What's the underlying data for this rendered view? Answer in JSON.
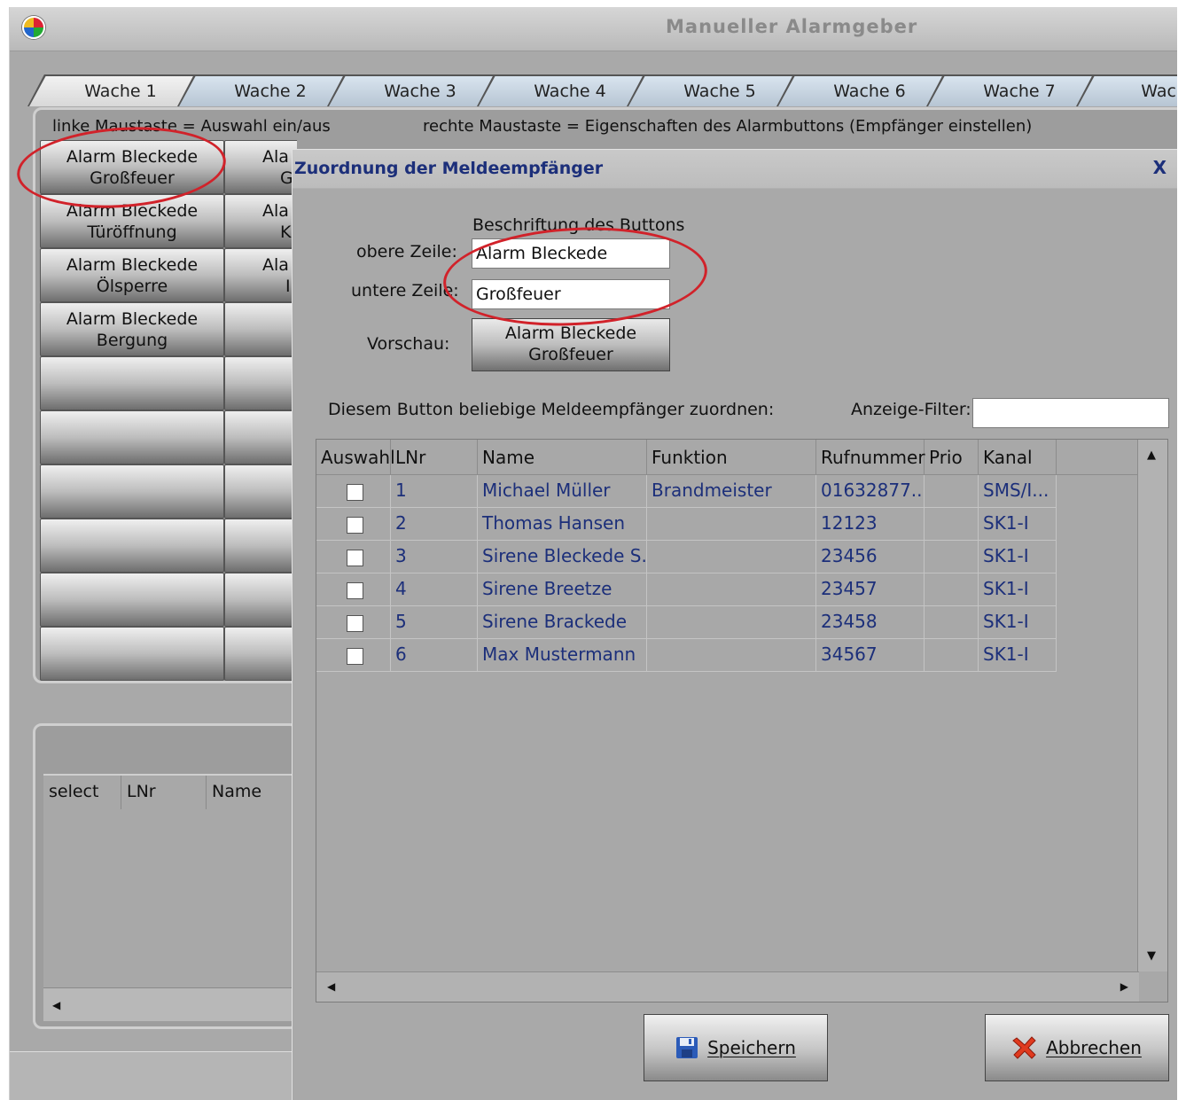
{
  "window": {
    "title": "Manueller Alarmgeber",
    "icon": "app-globe-icon"
  },
  "tabs": [
    "Wache 1",
    "Wache 2",
    "Wache 3",
    "Wache 4",
    "Wache 5",
    "Wache 6",
    "Wache 7",
    "Wache"
  ],
  "hints": {
    "left": "linke Maustaste = Auswahl ein/aus",
    "right": "rechte Maustaste = Eigenschaften des Alarmbuttons (Empfänger einstellen)"
  },
  "alarm_buttons": [
    {
      "line1": "Alarm Bleckede",
      "line2": "Großfeuer"
    },
    {
      "line1": "Alarm Bleckede",
      "line2": "Türöffnung"
    },
    {
      "line1": "Alarm Bleckede",
      "line2": "Ölsperre"
    },
    {
      "line1": "Alarm Bleckede",
      "line2": "Bergung"
    }
  ],
  "alarm_buttons_col2": [
    {
      "line1": "Ala",
      "line2": "G"
    },
    {
      "line1": "Ala",
      "line2": "K"
    },
    {
      "line1": "Ala",
      "line2": "I"
    }
  ],
  "lower_grid": {
    "headers": [
      "select",
      "LNr",
      "Name"
    ]
  },
  "dialog": {
    "title": "Zuordnung der Meldeempfänger",
    "close": "X",
    "caption_heading": "Beschriftung des Buttons",
    "upper_label": "obere Zeile:",
    "upper_value": "Alarm Bleckede",
    "lower_label": "untere Zeile:",
    "lower_value": "Großfeuer",
    "preview_label": "Vorschau:",
    "preview_line1": "Alarm Bleckede",
    "preview_line2": "Großfeuer",
    "assign_text": "Diesem Button beliebige  Meldeempfänger zuordnen:",
    "filter_label": "Anzeige-Filter:",
    "filter_value": "",
    "save_label": "Speichern",
    "cancel_label": "Abbrechen",
    "save_icon": "floppy-disk-icon",
    "cancel_icon": "red-x-icon"
  },
  "grid": {
    "headers": [
      "Auswahl",
      "LNr",
      "Name",
      "Funktion",
      "Rufnummer",
      "Prio",
      "Kanal"
    ],
    "rows": [
      {
        "lnr": "1",
        "name": "Michael Müller",
        "funktion": "Brandmeister",
        "ruf": "01632877...",
        "prio": "",
        "kanal": "SMS/I..."
      },
      {
        "lnr": "2",
        "name": "Thomas Hansen",
        "funktion": "",
        "ruf": "12123",
        "prio": "",
        "kanal": "SK1-I"
      },
      {
        "lnr": "3",
        "name": "Sirene Bleckede S...",
        "funktion": "",
        "ruf": "23456",
        "prio": "",
        "kanal": "SK1-I"
      },
      {
        "lnr": "4",
        "name": "Sirene Breetze",
        "funktion": "",
        "ruf": "23457",
        "prio": "",
        "kanal": "SK1-I"
      },
      {
        "lnr": "5",
        "name": "Sirene Brackede",
        "funktion": "",
        "ruf": "23458",
        "prio": "",
        "kanal": "SK1-I"
      },
      {
        "lnr": "6",
        "name": "Max Mustermann",
        "funktion": "",
        "ruf": "34567",
        "prio": "",
        "kanal": "SK1-I"
      }
    ]
  },
  "colors": {
    "accent_text": "#1c2f7a",
    "highlight_ring": "#d1222a"
  }
}
